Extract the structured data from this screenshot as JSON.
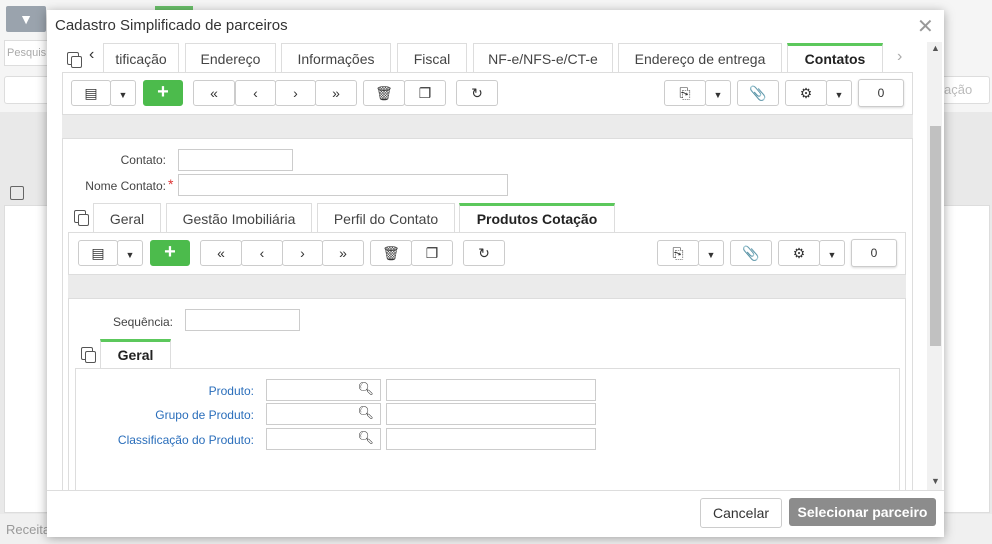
{
  "background": {
    "search_placeholder": "Pesquis",
    "right_text": "ação",
    "footer_label": "Receita"
  },
  "modal": {
    "title": "Cadastro Simplificado de parceiros",
    "top_tabs": [
      "tificação",
      "Endereço",
      "Informações",
      "Fiscal",
      "NF-e/NFS-e/CT-e",
      "Endereço de entrega",
      "Contatos"
    ],
    "active_top_tab": "Contatos",
    "counter_top": "0",
    "fields": {
      "contato_label": "Contato:",
      "nome_contato_label": "Nome Contato:",
      "required_mark": "*"
    },
    "inner_tabs": [
      "Geral",
      "Gestão Imobiliária",
      "Perfil do Contato",
      "Produtos Cotação"
    ],
    "active_inner_tab": "Produtos Cotação",
    "counter_inner": "0",
    "sequencia_label": "Sequência:",
    "sub_tab": "Geral",
    "product_fields": [
      {
        "label": "Produto:"
      },
      {
        "label": "Grupo de Produto:"
      },
      {
        "label": "Classificação do Produto:"
      }
    ],
    "cancel_label": "Cancelar",
    "select_label": "Selecionar parceiro"
  }
}
